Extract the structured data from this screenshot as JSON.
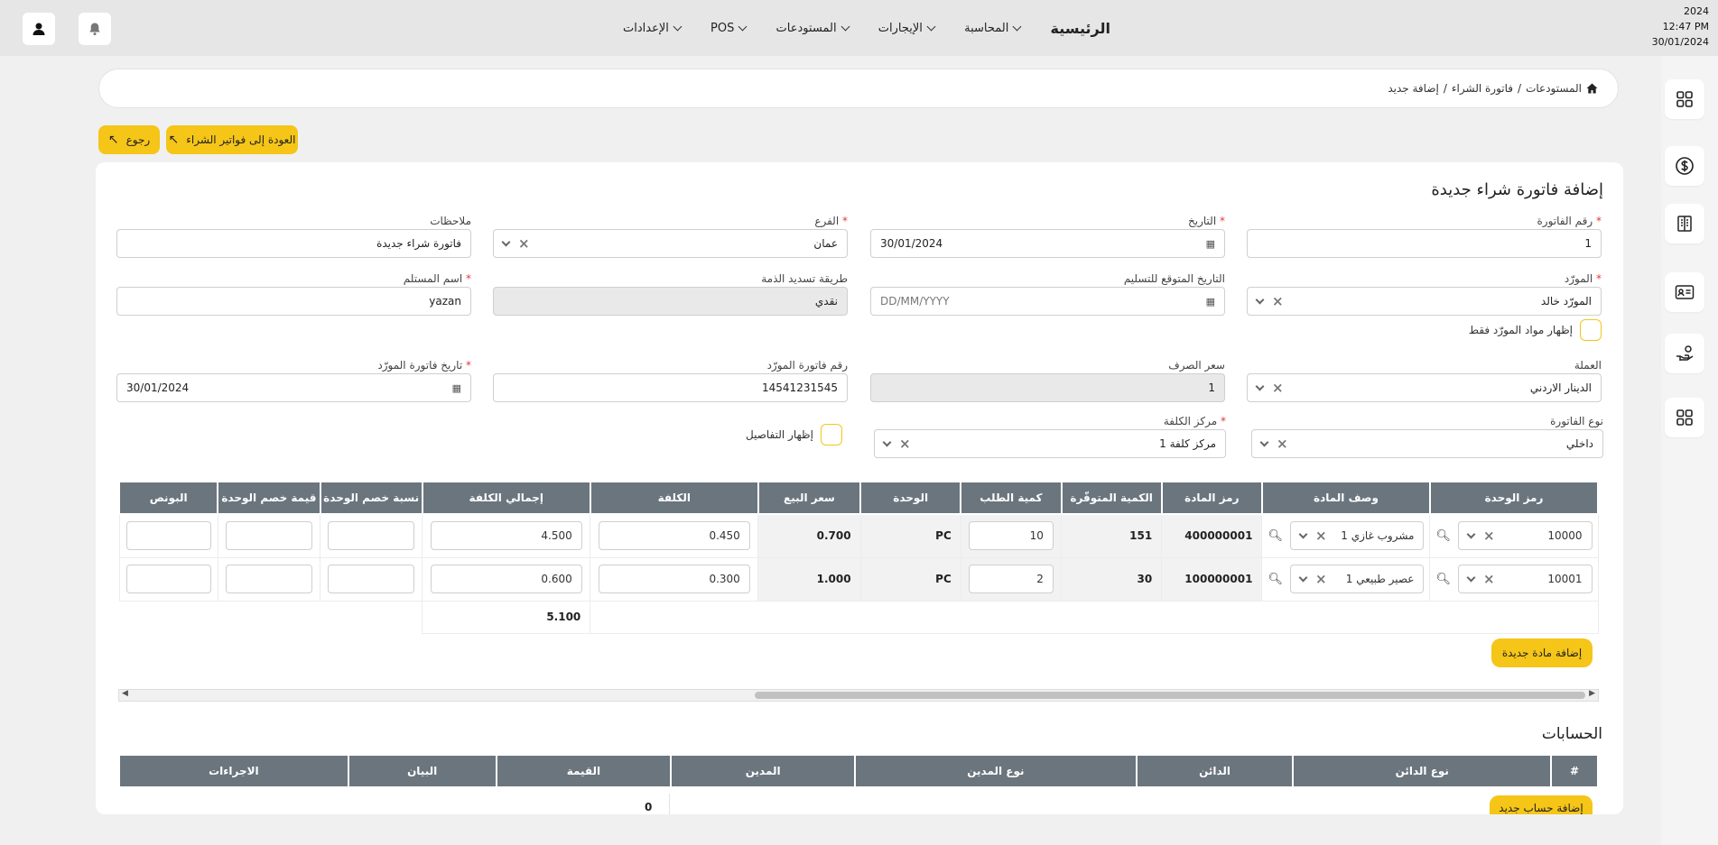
{
  "datetime": {
    "year": "2024",
    "time": "12:47 PM",
    "date": "30/01/2024"
  },
  "nav": {
    "home": "الرئيسية",
    "items": [
      "المحاسبة",
      "الإيجارات",
      "المستودعات",
      "POS",
      "الإعدادات"
    ]
  },
  "breadcrumb": {
    "items": [
      "المستودعات",
      "فاتورة الشراء",
      "إضافة جديد"
    ],
    "sep": "/"
  },
  "buttons": {
    "back_to_invoices": "العودة إلى فواتير الشراء",
    "back": "رجوع",
    "add_item": "إضافة مادة جديدة",
    "add_account": "إضافة حساب جديد"
  },
  "form": {
    "title": "إضافة فاتورة شراء جديدة",
    "invoice_no": {
      "label": "رقم الفاتورة",
      "value": "1"
    },
    "date": {
      "label": "التاريخ",
      "value": "30/01/2024"
    },
    "branch": {
      "label": "الفرع",
      "value": "عمان"
    },
    "notes": {
      "label": "ملاحظات",
      "value": "فاتورة شراء جديدة"
    },
    "supplier": {
      "label": "المورّد",
      "value": "المورّد خالد"
    },
    "expected_delivery": {
      "label": "التاريخ المتوقع للتسليم",
      "placeholder": "DD/MM/YYYY"
    },
    "payment_method": {
      "label": "طريقة تسديد الذمة",
      "value": "نقدي"
    },
    "receiver_name": {
      "label": "اسم المستلم",
      "value": "yazan"
    },
    "show_supplier_items": {
      "label": "إظهار مواد المورّد فقط"
    },
    "currency": {
      "label": "العملة",
      "value": "الدينار الاردني"
    },
    "exchange_rate": {
      "label": "سعر الصرف",
      "value": "1"
    },
    "supplier_invoice_no": {
      "label": "رقم فاتورة المورّد",
      "value": "14541231545"
    },
    "supplier_invoice_date": {
      "label": "تاريخ فاتورة المورّد",
      "value": "30/01/2024"
    },
    "invoice_type": {
      "label": "نوع الفاتورة",
      "value": "داخلي"
    },
    "cost_center": {
      "label": "مركز الكلفة",
      "value": "مركز كلفة 1"
    },
    "show_details": {
      "label": "إظهار التفاصيل"
    }
  },
  "items_table": {
    "headers": {
      "unit_code": "رمز الوحدة",
      "description": "وصف المادة",
      "item_code": "رمز المادة",
      "available_qty": "الكمية المتوفّرة",
      "order_qty": "كمية الطلب",
      "unit": "الوحدة",
      "sale_price": "سعر البيع",
      "cost": "الكلفة",
      "total_cost": "إجمالي الكلفة",
      "unit_discount_pct": "نسبة خصم الوحدة",
      "unit_discount_val": "قيمة خصم الوحدة",
      "bonus": "البونص"
    },
    "rows": [
      {
        "unit_code": "10000",
        "description": "مشروب غازي 1",
        "item_code": "400000001",
        "available_qty": "151",
        "order_qty": "10",
        "unit": "PC",
        "sale_price": "0.700",
        "cost": "0.450",
        "total_cost": "4.500"
      },
      {
        "unit_code": "10001",
        "description": "عصير طبيعي 1",
        "item_code": "100000001",
        "available_qty": "30",
        "order_qty": "2",
        "unit": "PC",
        "sale_price": "1.000",
        "cost": "0.300",
        "total_cost": "0.600"
      }
    ],
    "total": "5.100"
  },
  "accounts": {
    "title": "الحسابات",
    "headers": {
      "num": "#",
      "creditor_type": "نوع الدائن",
      "creditor": "الدائن",
      "debtor_type": "نوع المدين",
      "debtor": "المدين",
      "value": "القيمة",
      "statement": "البيان",
      "actions": "الاجراءات"
    },
    "total": "0"
  }
}
